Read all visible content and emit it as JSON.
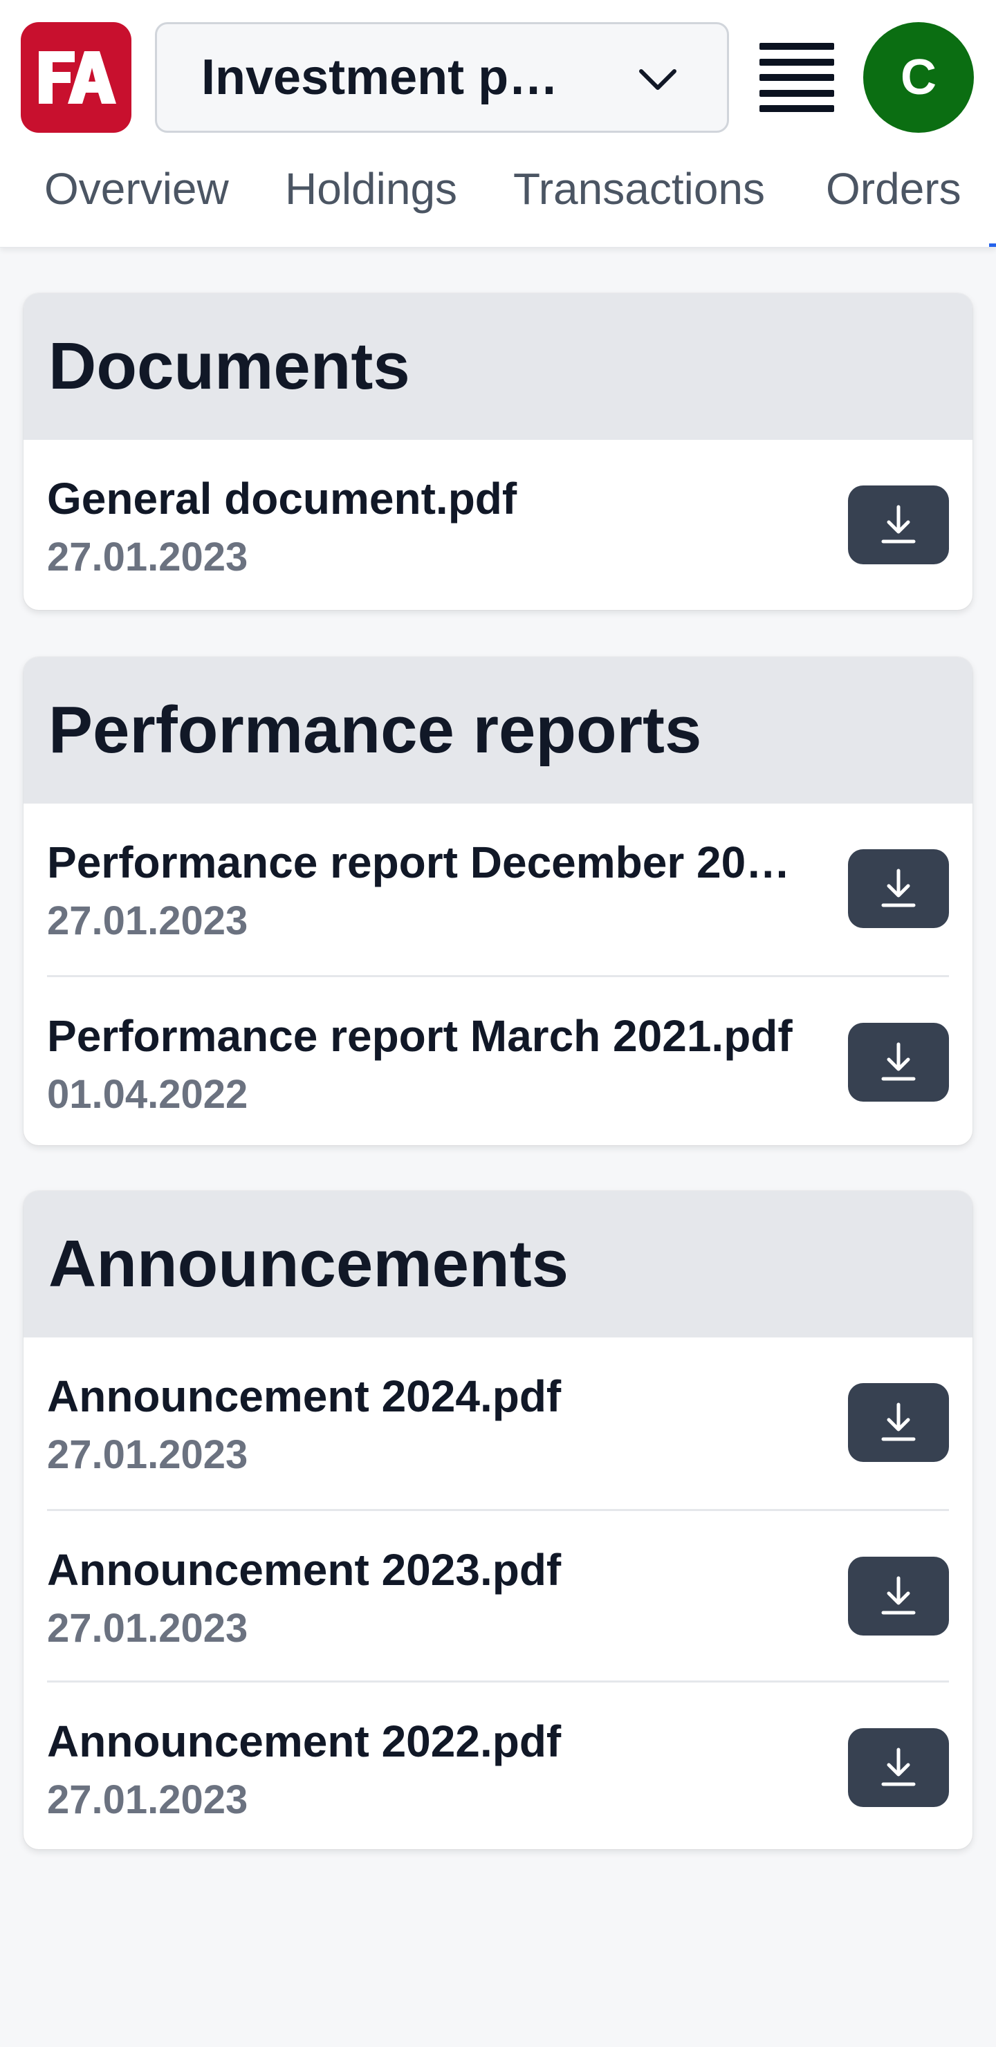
{
  "header": {
    "logo_text": "FA",
    "portfolio_select": "Investment po…",
    "avatar_initial": "C",
    "tabs": [
      {
        "label": "Overview"
      },
      {
        "label": "Holdings"
      },
      {
        "label": "Transactions"
      },
      {
        "label": "Orders"
      }
    ]
  },
  "colors": {
    "brand": "#c8102e",
    "avatar": "#0b6e12",
    "button": "#374151",
    "card_header": "#e5e7eb"
  },
  "sections": [
    {
      "title": "Documents",
      "items": [
        {
          "name": "General document.pdf",
          "date": "27.01.2023"
        }
      ]
    },
    {
      "title": "Performance reports",
      "items": [
        {
          "name": "Performance report December 20…",
          "date": "27.01.2023"
        },
        {
          "name": "Performance report March 2021.pdf",
          "date": "01.04.2022"
        }
      ]
    },
    {
      "title": "Announcements",
      "items": [
        {
          "name": "Announcement 2024.pdf",
          "date": "27.01.2023"
        },
        {
          "name": "Announcement 2023.pdf",
          "date": "27.01.2023"
        },
        {
          "name": "Announcement 2022.pdf",
          "date": "27.01.2023"
        }
      ]
    }
  ],
  "icons": {
    "download": "download-icon",
    "menu": "hamburger-menu-icon",
    "chevron": "chevron-down-icon"
  }
}
